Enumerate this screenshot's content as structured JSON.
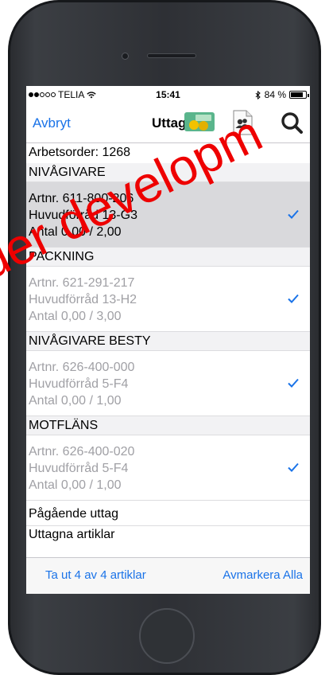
{
  "status_bar": {
    "carrier": "TELIA",
    "time": "15:41",
    "battery": "84 %",
    "battery_level": 0.84,
    "signal_bars_filled": 2,
    "signal_bars_total": 5
  },
  "navbar": {
    "cancel_label": "Avbryt",
    "title": "Uttag",
    "icons": [
      "money-logo-icon",
      "contacts-icon",
      "search-icon"
    ]
  },
  "order": {
    "label": "Arbetsorder: 1268"
  },
  "sections": [
    {
      "title": "NIVÅGIVARE",
      "item": {
        "artnr": "Artnr. 611-800-206",
        "location": "Huvudförråd 13-G3",
        "quantity": "Antal 0,00 / 2,00",
        "selected": true,
        "checked": true
      }
    },
    {
      "title": "PACKNING",
      "item": {
        "artnr": "Artnr. 621-291-217",
        "location": "Huvudförråd 13-H2",
        "quantity": "Antal 0,00 / 3,00",
        "selected": false,
        "checked": true
      }
    },
    {
      "title": "NIVÅGIVARE BESTY",
      "item": {
        "artnr": "Artnr. 626-400-000",
        "location": "Huvudförråd 5-F4",
        "quantity": "Antal 0,00 / 1,00",
        "selected": false,
        "checked": true
      }
    },
    {
      "title": "MOTFLÄNS",
      "item": {
        "artnr": "Artnr. 626-400-020",
        "location": "Huvudförråd 5-F4",
        "quantity": "Antal 0,00 / 1,00",
        "selected": false,
        "checked": true
      }
    }
  ],
  "pending_label": "Pågående uttag",
  "taken_label": "Uttagna artiklar",
  "toolbar": {
    "take_label": "Ta ut 4 av 4 artiklar",
    "deselect_label": "Avmarkera Alla"
  },
  "watermark": "der developm",
  "colors": {
    "accent": "#1a73e8",
    "selected_row": "#d9d9dc",
    "watermark": "#ee0000"
  }
}
